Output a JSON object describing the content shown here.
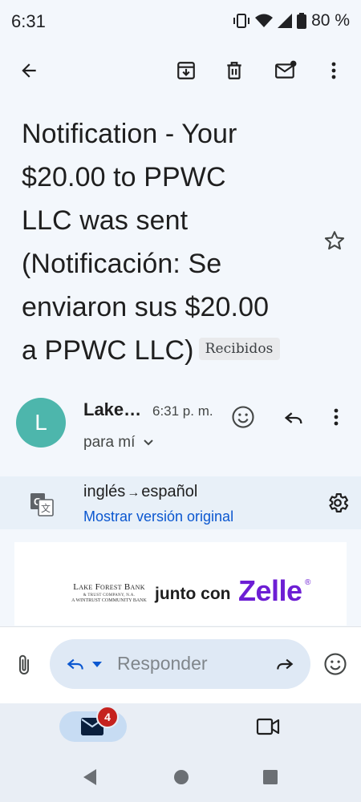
{
  "status_bar": {
    "time": "6:31",
    "battery": "80 %"
  },
  "toolbar": {
    "back": "arrow-back-icon",
    "archive": "archive-icon",
    "delete": "trash-icon",
    "mark_unread": "mark-unread-icon",
    "more": "more-vert-icon"
  },
  "subject": {
    "lines": [
      "Notification - Your",
      "$20.00 to PPWC",
      "LLC was sent",
      "(Notificación: Se",
      "enviaron sus $20.00",
      "a PPWC LLC)"
    ],
    "label": "Recibidos"
  },
  "sender": {
    "avatar_letter": "L",
    "avatar_color": "#4db6ac",
    "name": "Lake…",
    "time": "6:31 p. m.",
    "recipient": "para mí"
  },
  "translation": {
    "from": "inglés",
    "arrow": "→",
    "to": "español",
    "show_original": "Mostrar versión original"
  },
  "email_body": {
    "bank_name": "Lake Forest Bank",
    "bank_tagline": "& TRUST COMPANY, N.A.",
    "bank_parent": "A WINTRUST COMMUNITY BANK",
    "junto": "junto con",
    "zelle": "Zelle",
    "zelle_reg": "®",
    "zelle_color": "#6d1ed4"
  },
  "reply": {
    "placeholder": "Responder"
  },
  "bottom_nav": {
    "mail_badge": "4"
  },
  "colors": {
    "accent_link": "#0b57d0",
    "badge": "#c5221f"
  }
}
